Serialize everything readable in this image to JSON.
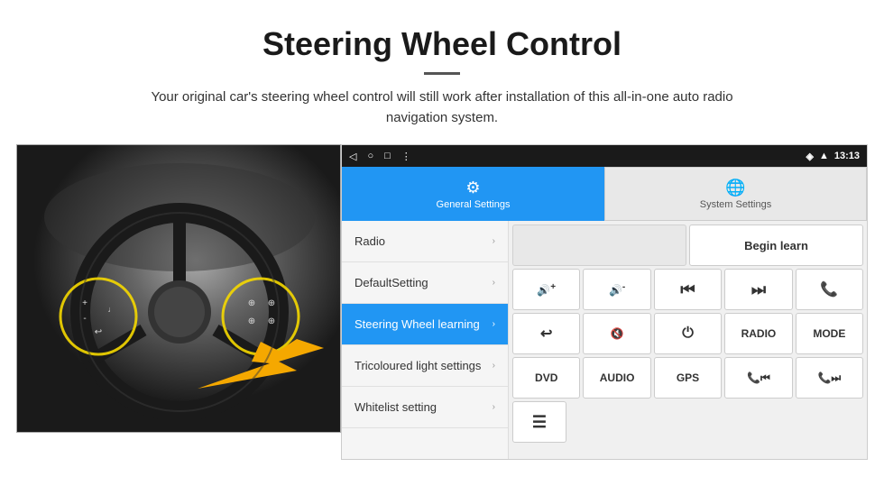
{
  "header": {
    "title": "Steering Wheel Control",
    "subtitle": "Your original car's steering wheel control will still work after installation of this all-in-one auto radio navigation system."
  },
  "status_bar": {
    "time": "13:13",
    "back_icon": "◁",
    "home_icon": "○",
    "square_icon": "□",
    "menu_icon": "⋮"
  },
  "tabs": [
    {
      "label": "General Settings",
      "icon": "⚙",
      "active": true
    },
    {
      "label": "System Settings",
      "icon": "🌐",
      "active": false
    }
  ],
  "menu_items": [
    {
      "label": "Radio",
      "active": false
    },
    {
      "label": "DefaultSetting",
      "active": false
    },
    {
      "label": "Steering Wheel learning",
      "active": true
    },
    {
      "label": "Tricoloured light settings",
      "active": false
    },
    {
      "label": "Whitelist setting",
      "active": false
    }
  ],
  "controls": {
    "begin_learn_label": "Begin learn",
    "buttons_row2": [
      "🔊+",
      "🔊-",
      "⏮",
      "⏭",
      "📞"
    ],
    "buttons_row3": [
      "↩",
      "🔊×",
      "⏻",
      "RADIO",
      "MODE"
    ],
    "buttons_row4": [
      "DVD",
      "AUDIO",
      "GPS",
      "📞⏮",
      "📞⏭"
    ],
    "buttons_row5": [
      "📋"
    ]
  }
}
